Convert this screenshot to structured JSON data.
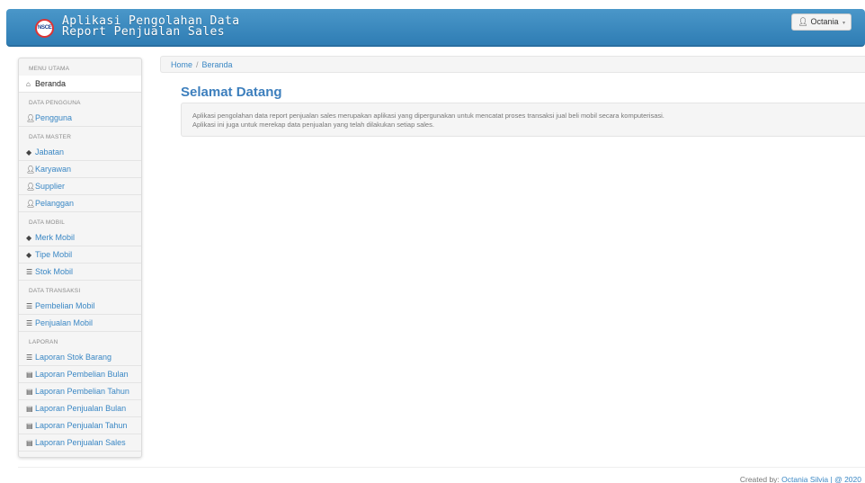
{
  "app": {
    "logo_text": "NSCE",
    "title_line1": "Aplikasi Pengolahan Data",
    "title_line2": "Report Penjualan Sales"
  },
  "user_menu": {
    "icon": "user-icon",
    "label": "Octania"
  },
  "sidebar": {
    "sections": [
      {
        "header": "MENU UTAMA",
        "items": [
          {
            "label": "Beranda",
            "icon": "home-icon",
            "active": true
          }
        ]
      },
      {
        "header": "DATA PENGGUNA",
        "items": [
          {
            "label": "Pengguna",
            "icon": "user-icon"
          }
        ]
      },
      {
        "header": "DATA MASTER",
        "items": [
          {
            "label": "Jabatan",
            "icon": "tag-icon"
          },
          {
            "label": "Karyawan",
            "icon": "user-icon"
          },
          {
            "label": "Supplier",
            "icon": "user-icon"
          },
          {
            "label": "Pelanggan",
            "icon": "user-icon"
          }
        ]
      },
      {
        "header": "DATA MOBIL",
        "items": [
          {
            "label": "Merk Mobil",
            "icon": "tag-icon"
          },
          {
            "label": "Tipe Mobil",
            "icon": "tag-icon"
          },
          {
            "label": "Stok Mobil",
            "icon": "list-icon"
          }
        ]
      },
      {
        "header": "DATA TRANSAKSI",
        "items": [
          {
            "label": "Pembelian Mobil",
            "icon": "list-icon"
          },
          {
            "label": "Penjualan Mobil",
            "icon": "list-icon"
          }
        ]
      },
      {
        "header": "LAPORAN",
        "items": [
          {
            "label": "Laporan Stok Barang",
            "icon": "list-icon"
          },
          {
            "label": "Laporan Pembelian Bulan",
            "icon": "report-icon"
          },
          {
            "label": "Laporan Pembelian Tahun",
            "icon": "report-icon"
          },
          {
            "label": "Laporan Penjualan Bulan",
            "icon": "report-icon"
          },
          {
            "label": "Laporan Penjualan Tahun",
            "icon": "report-icon"
          },
          {
            "label": "Laporan Penjualan Sales",
            "icon": "report-icon"
          }
        ]
      }
    ]
  },
  "breadcrumb": {
    "home": "Home",
    "separator": "/",
    "current": "Beranda"
  },
  "main": {
    "title": "Selamat Datang",
    "description_line1": "Aplikasi pengolahan data report penjualan sales merupakan aplikasi yang dipergunakan untuk mencatat proses transaksi jual beli mobil secara komputerisasi.",
    "description_line2": "Aplikasi ini juga untuk merekap data penjualan yang telah dilakukan setiap sales."
  },
  "footer": {
    "prefix": "Created by:",
    "author": "Octania Silvia",
    "suffix": "| @ 2020"
  },
  "colors": {
    "navbar": "#3a8ac0",
    "link": "#3a87c4",
    "title": "#3d7fbd"
  }
}
